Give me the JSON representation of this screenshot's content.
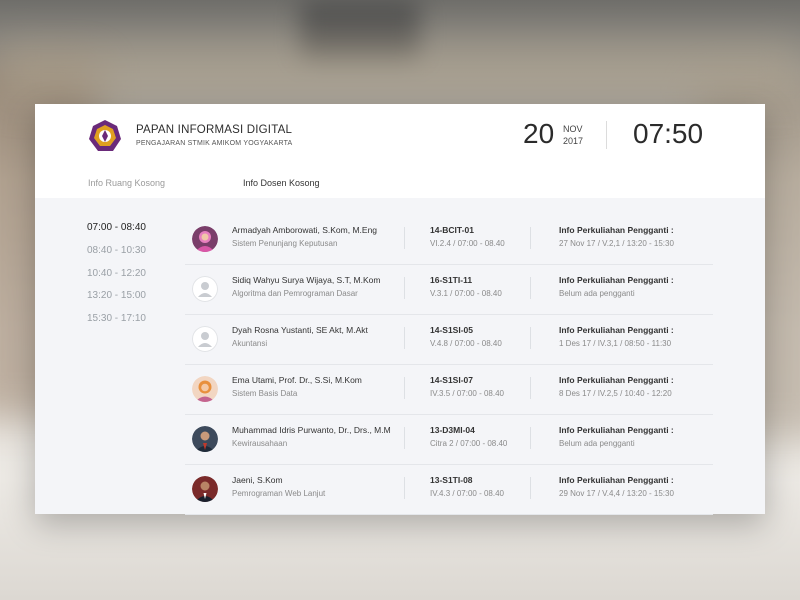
{
  "header": {
    "title": "PAPAN INFORMASI DIGITAL",
    "subtitle": "PENGAJARAN STMIK AMIKOM YOGYAKARTA",
    "date_day": "20",
    "date_month": "NOV",
    "date_year": "2017",
    "time": "07:50"
  },
  "tabs": [
    {
      "label": "Info Ruang Kosong",
      "active": false
    },
    {
      "label": "Info Dosen Kosong",
      "active": true
    }
  ],
  "time_slots": [
    "07:00 - 08:40",
    "08:40 - 10:30",
    "10:40 - 12:20",
    "13:20 - 15:00",
    "15:30 - 17:10"
  ],
  "active_time_slot": "07:00 - 08:40",
  "lecturers": [
    {
      "name": "Armadyah Amborowati, S.Kom, M.Eng",
      "subject": "Sistem Penunjang Keputusan",
      "code": "14-BCIT-01",
      "room": "VI.2.4 / 07:00 - 08.40",
      "info_label": "Info Perkuliahan Pengganti :",
      "info_value": "27 Nov 17 / V.2,1 / 13:20 - 15:30",
      "avatar": "photo-avatar"
    },
    {
      "name": "Sidiq Wahyu Surya Wijaya, S.T, M.Kom",
      "subject": "Algoritma dan Pemrograman Dasar",
      "code": "16-S1TI-11",
      "room": "V.3.1 / 07:00 - 08.40",
      "info_label": "Info Perkuliahan Pengganti :",
      "info_value": "Belum ada pengganti",
      "avatar": "placeholder-avatar"
    },
    {
      "name": "Dyah Rosna Yustanti, SE Akt, M.Akt",
      "subject": "Akuntansi",
      "code": "14-S1SI-05",
      "room": "V.4.8 / 07:00 - 08.40",
      "info_label": "Info Perkuliahan Pengganti :",
      "info_value": "1 Des 17 / IV.3,1 / 08:50 - 11:30",
      "avatar": "placeholder-avatar"
    },
    {
      "name": "Ema Utami, Prof. Dr., S.Si, M.Kom",
      "subject": "Sistem Basis Data",
      "code": "14-S1SI-07",
      "room": "IV.3.5 / 07:00 - 08.40",
      "info_label": "Info Perkuliahan Pengganti :",
      "info_value": "8 Des 17 / IV.2,5 / 10:40 - 12:20",
      "avatar": "photo-avatar"
    },
    {
      "name": "Muhammad Idris Purwanto, Dr., Drs., M.M",
      "subject": "Kewirausahaan",
      "code": "13-D3MI-04",
      "room": "Citra 2 / 07:00 - 08.40",
      "info_label": "Info Perkuliahan Pengganti :",
      "info_value": "Belum ada pengganti",
      "avatar": "photo-avatar"
    },
    {
      "name": "Jaeni, S.Kom",
      "subject": "Pemrograman Web Lanjut",
      "code": "13-S1TI-08",
      "room": "IV.4.3 / 07:00 - 08.40",
      "info_label": "Info Perkuliahan Pengganti :",
      "info_value": "29 Nov 17 / V.4,4 / 13:20 - 15:30",
      "avatar": "photo-avatar"
    }
  ],
  "colors": {
    "logo_purple": "#6a2a7a",
    "logo_gold": "#e0a020",
    "text_dark": "#333333",
    "text_muted": "#8a8a8a",
    "panel_bg": "#f4f5f8"
  }
}
